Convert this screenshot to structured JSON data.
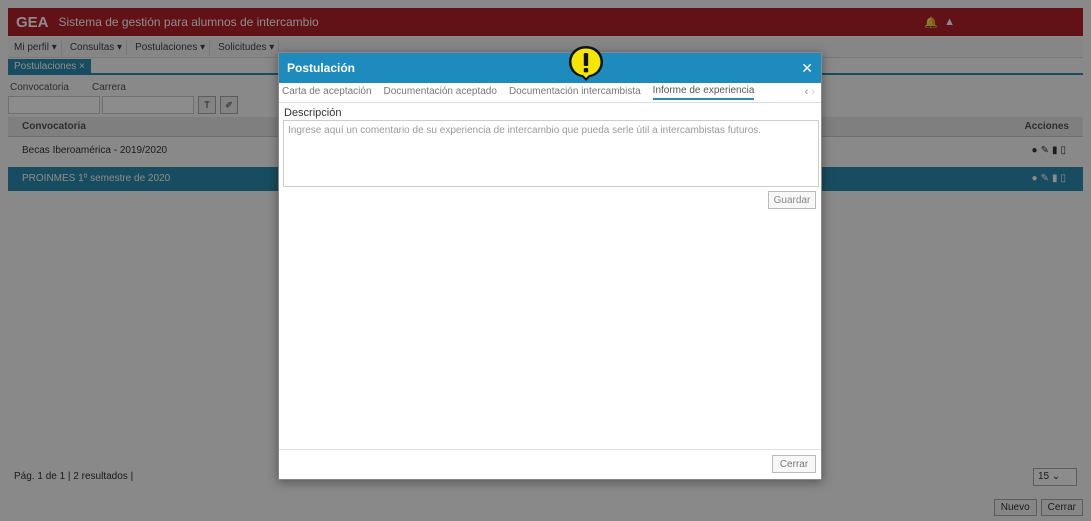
{
  "header": {
    "brand": "GEA",
    "title": "Sistema de gestión para alumnos de intercambio"
  },
  "menu": [
    "Mi perfil ▾",
    "Consultas ▾",
    "Postulaciones ▾",
    "Solicitudes ▾"
  ],
  "open_tab": "Postulaciones",
  "filters": {
    "convocatoria": "Convocatoria",
    "carrera": "Carrera"
  },
  "grid": {
    "headers": {
      "convocatoria": "Convocatoria",
      "acciones": "Acciones"
    },
    "rows": [
      "Becas Iberoamérica - 2019/2020",
      "PROINMES 1º semestre de 2020"
    ]
  },
  "pager": {
    "text": "Pág. 1 de 1 | 2 resultados |",
    "page_size": "15"
  },
  "bottom": {
    "nuevo": "Nuevo",
    "cerrar": "Cerrar"
  },
  "modal": {
    "title": "Postulación",
    "tabs": [
      "Carta de aceptación",
      "Documentación aceptado",
      "Documentación intercambista",
      "Informe de experiencia"
    ],
    "active_tab": 3,
    "field_label": "Descripción",
    "placeholder": "Ingrese aquí un comentario de su experiencia de intercambio que pueda serle útil a intercambistas futuros.",
    "save_label": "Guardar",
    "close_label": "Cerrar"
  },
  "colors": {
    "header_red": "#b3202a",
    "modal_blue": "#1e8bbf",
    "accent": "#2c8ab0",
    "warning_yellow": "#f5e600"
  },
  "icons": {
    "warning": "exclamation-icon",
    "close": "close-icon",
    "bell": "bell-icon",
    "user": "user-icon"
  }
}
